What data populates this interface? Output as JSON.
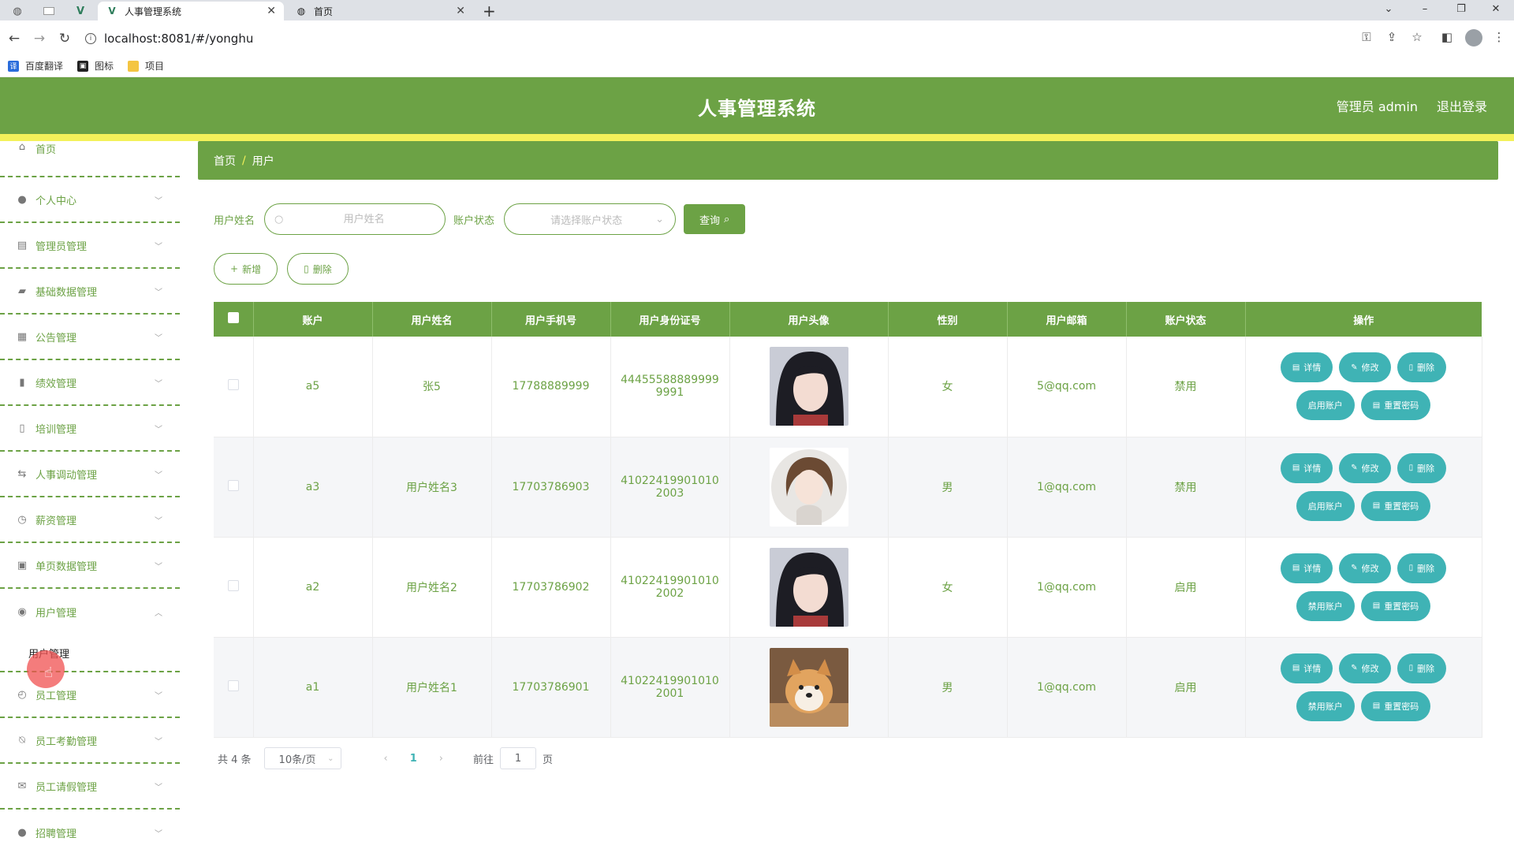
{
  "browser": {
    "tabs": [
      {
        "label": "人事管理系统",
        "active": true
      },
      {
        "label": "首页",
        "active": false
      }
    ],
    "url": "localhost:8081/#/yonghu",
    "bookmarks": [
      "百度翻译",
      "图标",
      "项目"
    ]
  },
  "header": {
    "title": "人事管理系统",
    "user": "管理员 admin",
    "logout": "退出登录"
  },
  "sidebar": {
    "items": [
      {
        "label": "首页",
        "icon": "home-icon"
      },
      {
        "label": "个人中心",
        "icon": "user-icon"
      },
      {
        "label": "管理员管理",
        "icon": "id-card-icon"
      },
      {
        "label": "基础数据管理",
        "icon": "folder-icon"
      },
      {
        "label": "公告管理",
        "icon": "grid-icon"
      },
      {
        "label": "绩效管理",
        "icon": "chart-icon"
      },
      {
        "label": "培训管理",
        "icon": "thermometer-icon"
      },
      {
        "label": "人事调动管理",
        "icon": "transfer-icon"
      },
      {
        "label": "薪资管理",
        "icon": "clock-icon"
      },
      {
        "label": "单页数据管理",
        "icon": "clipboard-icon"
      },
      {
        "label": "用户管理",
        "icon": "pin-icon"
      },
      {
        "label": "员工管理",
        "icon": "time-icon"
      },
      {
        "label": "员工考勤管理",
        "icon": "bell-off-icon"
      },
      {
        "label": "员工请假管理",
        "icon": "mail-icon"
      },
      {
        "label": "招聘管理",
        "icon": "person-icon"
      }
    ],
    "submenu_label": "用户管理"
  },
  "breadcrumb": {
    "home": "首页",
    "current": "用户"
  },
  "search": {
    "name_label": "用户姓名",
    "name_placeholder": "用户姓名",
    "status_label": "账户状态",
    "status_placeholder": "请选择账户状态",
    "query_button": "查询"
  },
  "actions": {
    "add": "新增",
    "delete": "删除"
  },
  "table": {
    "headers": [
      "账户",
      "用户姓名",
      "用户手机号",
      "用户身份证号",
      "用户头像",
      "性别",
      "用户邮箱",
      "账户状态",
      "操作"
    ],
    "rows": [
      {
        "account": "a5",
        "name": "张5",
        "phone": "17788889999",
        "idcard": "444555888899999991",
        "gender": "女",
        "email": "5@qq.com",
        "status": "禁用",
        "toggle": "启用账户",
        "avatar": "girl-photo"
      },
      {
        "account": "a3",
        "name": "用户姓名3",
        "phone": "17703786903",
        "idcard": "410224199010102003",
        "gender": "男",
        "email": "1@qq.com",
        "status": "禁用",
        "toggle": "启用账户",
        "avatar": "illustration-girl"
      },
      {
        "account": "a2",
        "name": "用户姓名2",
        "phone": "17703786902",
        "idcard": "410224199010102002",
        "gender": "女",
        "email": "1@qq.com",
        "status": "启用",
        "toggle": "禁用账户",
        "avatar": "girl-photo"
      },
      {
        "account": "a1",
        "name": "用户姓名1",
        "phone": "17703786901",
        "idcard": "410224199010102001",
        "gender": "男",
        "email": "1@qq.com",
        "status": "启用",
        "toggle": "禁用账户",
        "avatar": "dog-photo"
      }
    ],
    "op_labels": {
      "detail": "详情",
      "edit": "修改",
      "delete": "删除",
      "reset": "重置密码"
    }
  },
  "pagination": {
    "total": "共 4 条",
    "page_size": "10条/页",
    "current_page": "1",
    "goto_label": "前往",
    "goto_value": "1",
    "page_suffix": "页"
  },
  "colors": {
    "primary": "#6ca245",
    "accent_yellow": "#f3f15a",
    "op_button": "#3fb3b5"
  }
}
